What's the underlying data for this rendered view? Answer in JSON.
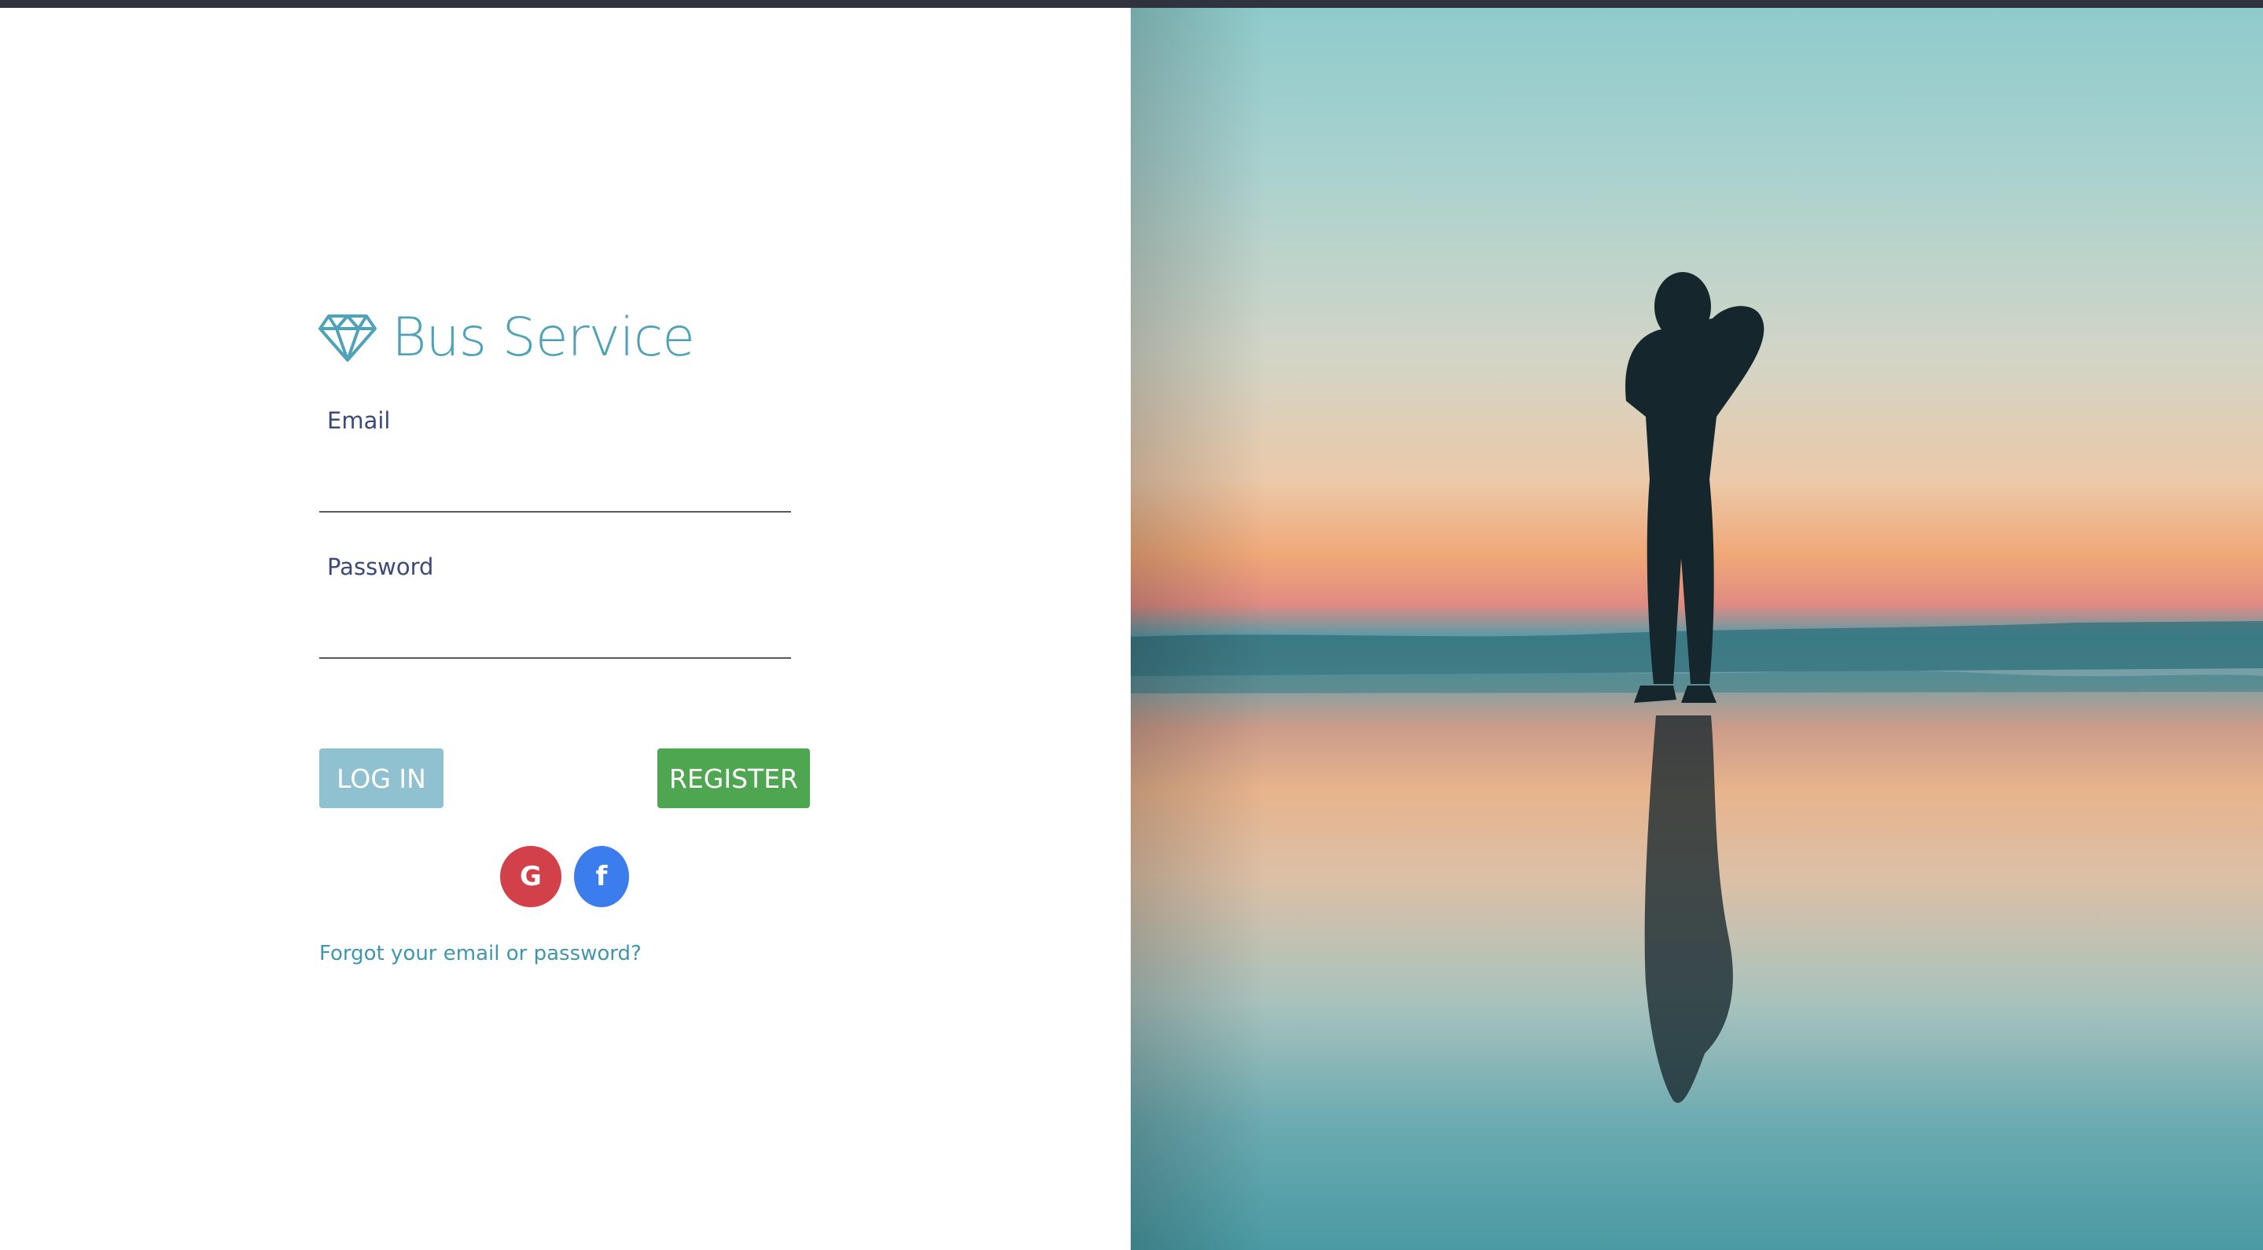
{
  "app": {
    "title": "Bus Service"
  },
  "form": {
    "email_label": "Email",
    "email_value": "",
    "email_placeholder": "",
    "password_label": "Password",
    "password_value": "",
    "password_placeholder": ""
  },
  "buttons": {
    "login_label": "LOG IN",
    "register_label": "REGISTER"
  },
  "social": {
    "google_label": "G",
    "facebook_label": "f"
  },
  "links": {
    "forgot_label": "Forgot your email or password?"
  },
  "icons": {
    "brand": "diamond-icon",
    "google": "google-icon",
    "facebook": "facebook-icon"
  },
  "colors": {
    "brand": "#4fa2b8",
    "login": "#8fc1d1",
    "register": "#4fa651",
    "google": "#d2404a",
    "facebook": "#3b7ded",
    "label": "#3a4a7a",
    "topbar": "#2f333d"
  }
}
